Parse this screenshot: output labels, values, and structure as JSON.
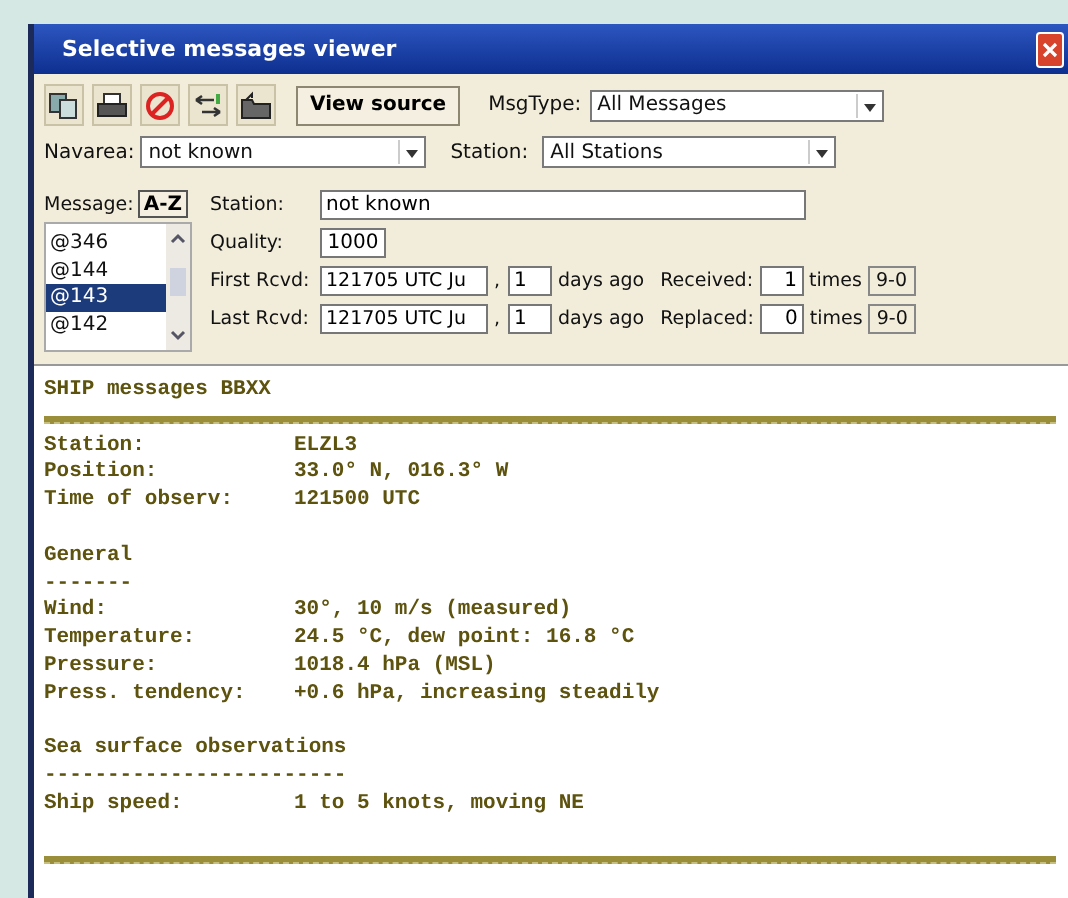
{
  "window": {
    "title": "Selective messages viewer"
  },
  "toolbar": {
    "view_source": "View source",
    "msgtype": {
      "label": "MsgType:",
      "value": "All Messages"
    }
  },
  "filters": {
    "navarea": {
      "label": "Navarea:",
      "value": "not known"
    },
    "station": {
      "label": "Station:",
      "value": "All Stations"
    }
  },
  "details": {
    "message_label": "Message:",
    "sort_button": "A-Z",
    "messages": [
      {
        "label": "@346",
        "selected": false
      },
      {
        "label": "@144",
        "selected": false
      },
      {
        "label": "@143",
        "selected": true
      },
      {
        "label": "@142",
        "selected": false
      }
    ],
    "station": {
      "label": "Station:",
      "value": "not known"
    },
    "quality": {
      "label": "Quality:",
      "value": "1000"
    },
    "received_rows": [
      {
        "label": "First Rcvd:",
        "time": "121705 UTC Ju",
        "separator": ",",
        "days": "1",
        "days_label": "days ago",
        "count_label": "Received:",
        "count": "1",
        "times_label": "times",
        "code": "9-0"
      },
      {
        "label": "Last Rcvd:",
        "time": "121705 UTC Ju",
        "separator": ",",
        "days": "1",
        "days_label": "days ago",
        "count_label": "Replaced:",
        "count": "0",
        "times_label": "times",
        "code": "9-0"
      }
    ]
  },
  "report": {
    "lines": [
      {
        "kind": "title",
        "text": "SHIP messages BBXX"
      },
      {
        "kind": "rule"
      },
      {
        "kind": "field",
        "label": "Station:",
        "value": "ELZL3"
      },
      {
        "kind": "field",
        "label": "Position:",
        "value": "33.0° N, 016.3° W"
      },
      {
        "kind": "field",
        "label": "Time of observ:",
        "value": "121500 UTC"
      },
      {
        "kind": "blank"
      },
      {
        "kind": "heading",
        "text": "General"
      },
      {
        "kind": "underline",
        "text": "-------"
      },
      {
        "kind": "field",
        "label": "Wind:",
        "value": "30°, 10 m/s (measured)"
      },
      {
        "kind": "field",
        "label": "Temperature:",
        "value": "24.5 °C, dew point: 16.8 °C"
      },
      {
        "kind": "field",
        "label": "Pressure:",
        "value": "1018.4 hPa (MSL)"
      },
      {
        "kind": "field",
        "label": "Press. tendency:",
        "value": "+0.6 hPa, increasing steadily"
      },
      {
        "kind": "blank"
      },
      {
        "kind": "heading",
        "text": "Sea surface observations"
      },
      {
        "kind": "underline",
        "text": "------------------------"
      },
      {
        "kind": "field",
        "label": "Ship speed:",
        "value": "1 to 5 knots, moving NE"
      },
      {
        "kind": "blank"
      },
      {
        "kind": "rule"
      }
    ]
  }
}
